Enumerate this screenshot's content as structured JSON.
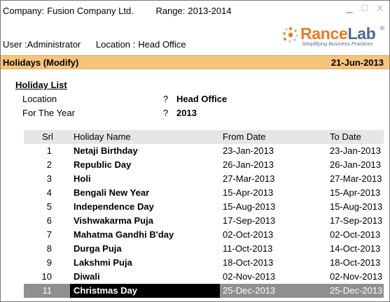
{
  "header": {
    "company_label": "Company:",
    "company_value": "Fusion Company Ltd.",
    "range_label": "Range:",
    "range_value": "2013-2014",
    "user_label": "User :",
    "user_value": "Administrator",
    "location_label": "Location :",
    "location_value": "Head Office"
  },
  "window_controls": {
    "minimize": "▁",
    "maximize": "☐",
    "close": "X"
  },
  "logo": {
    "brand_part1": "Rance",
    "brand_part2": "Lab",
    "registered": "®",
    "tagline": "Simplifying Business Practices",
    "colors": {
      "orange": "#ee7a22",
      "blue": "#4a6a96"
    }
  },
  "titlebar": {
    "title": "Holidays (Modify)",
    "date": "21-Jun-2013",
    "color": "#f7c57a"
  },
  "holiday_list": {
    "section_title": "Holiday List",
    "location_label": "Location",
    "location_value": "Head Office",
    "year_label": "For The Year",
    "year_value": "2013",
    "separator": "?"
  },
  "table": {
    "columns": [
      "Srl",
      "Holiday Name",
      "From Date",
      "To Date"
    ],
    "rows": [
      {
        "srl": "1",
        "name": "Netaji Birthday",
        "from": "23-Jan-2013",
        "to": "23-Jan-2013"
      },
      {
        "srl": "2",
        "name": "Republic Day",
        "from": "26-Jan-2013",
        "to": "26-Jan-2013"
      },
      {
        "srl": "3",
        "name": "Holi",
        "from": "27-Mar-2013",
        "to": "27-Mar-2013"
      },
      {
        "srl": "4",
        "name": "Bengali New Year",
        "from": "15-Apr-2013",
        "to": "15-Apr-2013"
      },
      {
        "srl": "5",
        "name": "Independence Day",
        "from": "15-Aug-2013",
        "to": "15-Aug-2013"
      },
      {
        "srl": "6",
        "name": "Vishwakarma Puja",
        "from": "17-Sep-2013",
        "to": "17-Sep-2013"
      },
      {
        "srl": "7",
        "name": "Mahatma Gandhi B'day",
        "from": "02-Oct-2013",
        "to": "02-Oct-2013"
      },
      {
        "srl": "8",
        "name": "Durga Puja",
        "from": "11-Oct-2013",
        "to": "14-Oct-2013"
      },
      {
        "srl": "9",
        "name": "Lakshmi Puja",
        "from": "18-Oct-2013",
        "to": "18-Oct-2013"
      },
      {
        "srl": "10",
        "name": "Diwali",
        "from": "02-Nov-2013",
        "to": "02-Nov-2013"
      },
      {
        "srl": "11",
        "name": "Christmas Day",
        "from": "25-Dec-2013",
        "to": "25-Dec-2013"
      }
    ],
    "selected_srl": "11"
  }
}
